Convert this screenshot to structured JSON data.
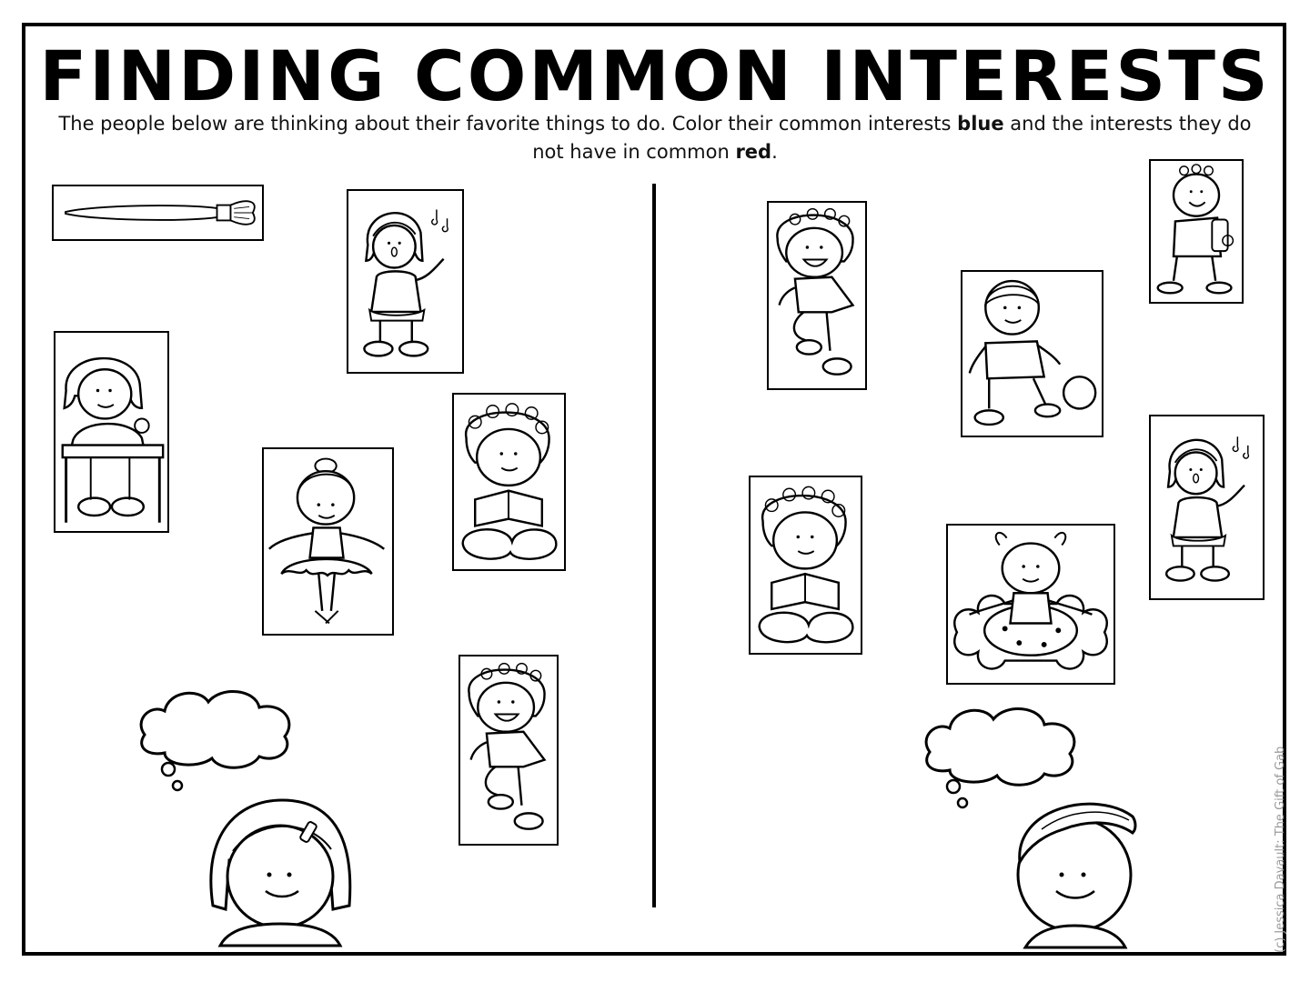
{
  "title": "FINDING COMMON INTERESTS",
  "instructions": {
    "text_before_blue": "The people below are thinking about their favorite things to do. Color their common interests ",
    "blue_word": "blue",
    "text_middle": " and the interests they do not have in common ",
    "red_word": "red",
    "text_end": "."
  },
  "left_panel": {
    "person": "girl",
    "interests": [
      "painting-icon",
      "singing-icon",
      "writing-icon",
      "ballet-icon",
      "reading-icon",
      "dancing-icon"
    ]
  },
  "right_panel": {
    "person": "boy",
    "interests": [
      "dancing-icon",
      "hiking-icon",
      "soccer-icon",
      "singing-icon",
      "reading-icon",
      "swimming-icon"
    ]
  },
  "credit": "(c) Jessica Davault: The Gift of Gab",
  "colors": {
    "ink": "#000000",
    "credit": "#9a9a9a"
  }
}
